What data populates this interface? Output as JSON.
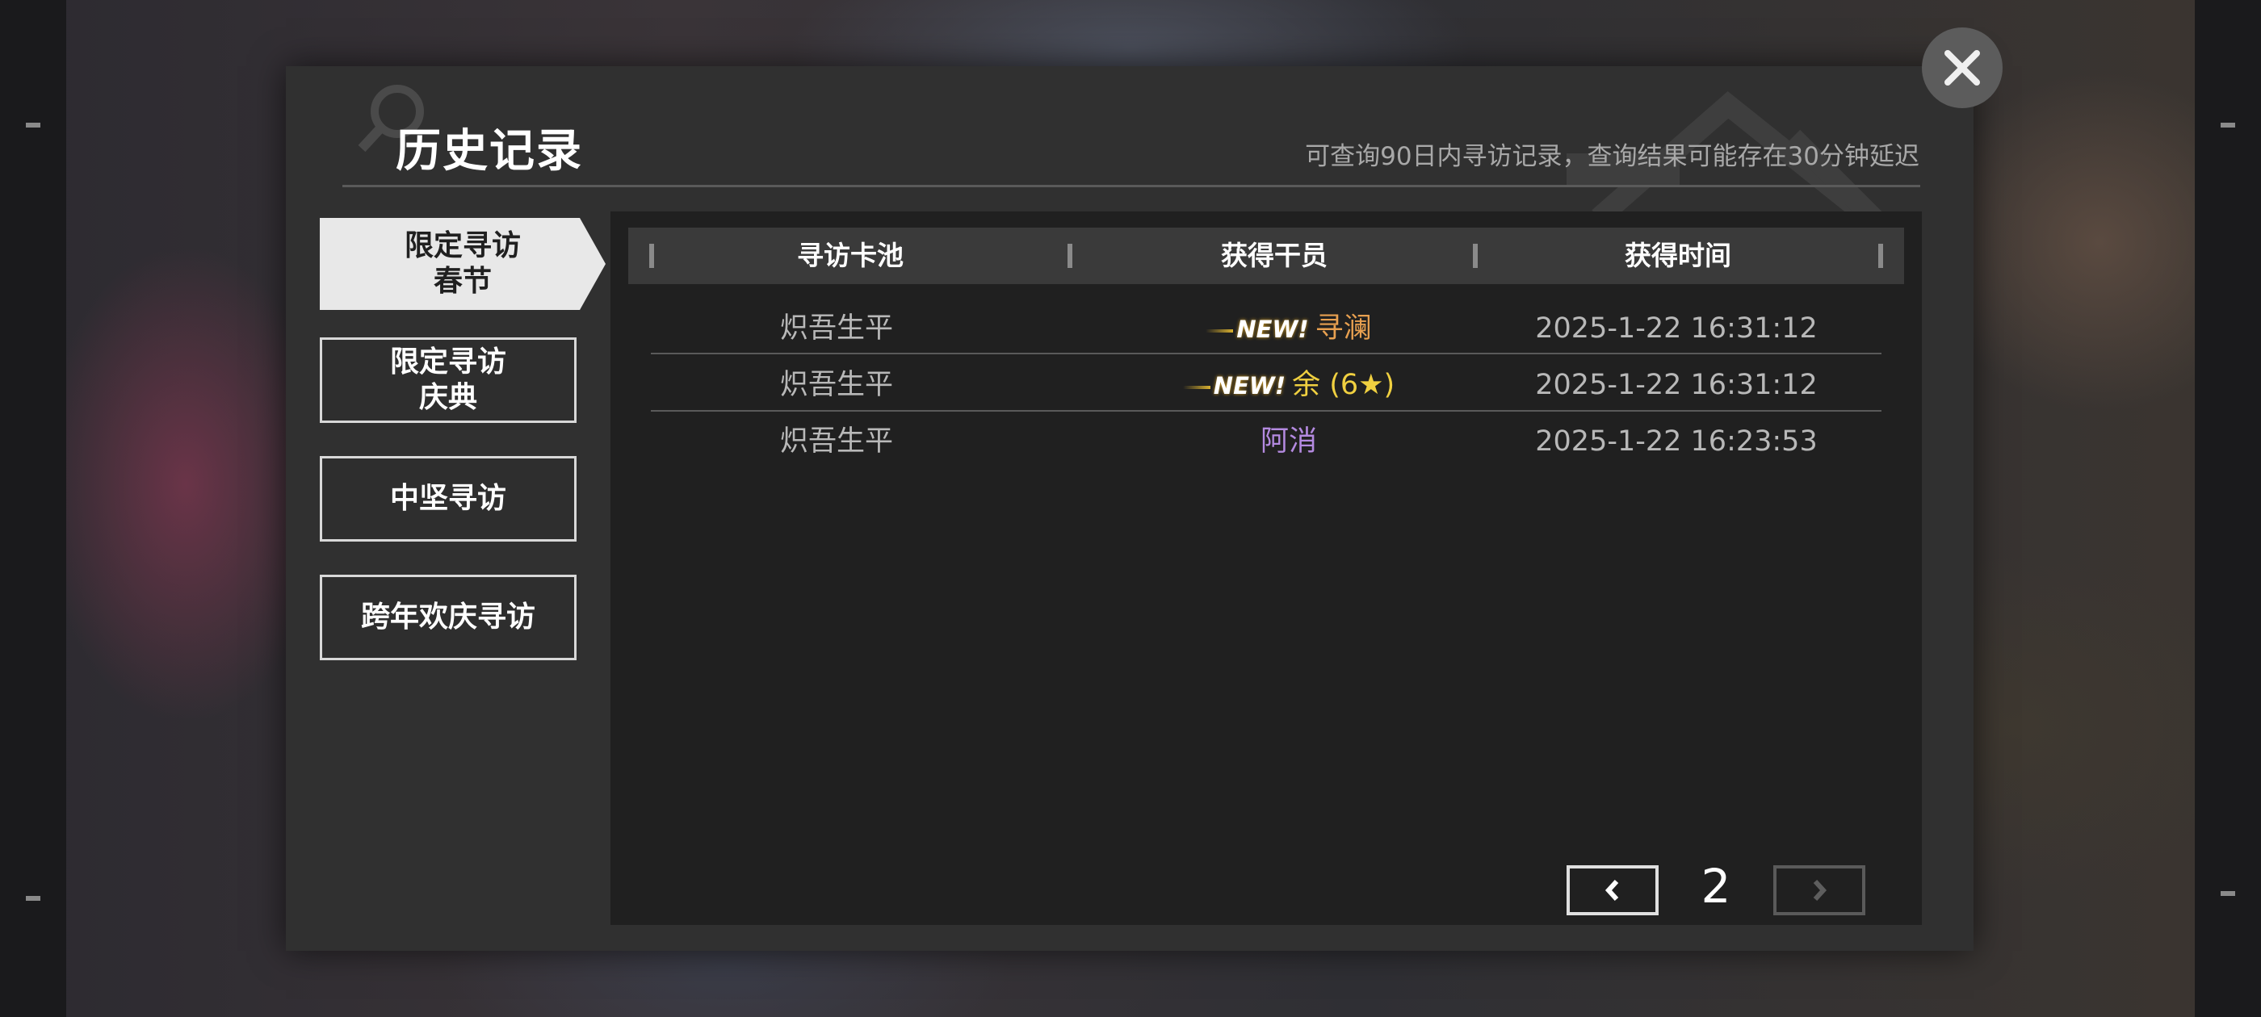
{
  "header": {
    "title": "历史记录",
    "subtitle": "可查询90日内寻访记录，查询结果可能存在30分钟延迟"
  },
  "close_icon": "close-icon",
  "sidebar": {
    "items": [
      {
        "line1": "限定寻访",
        "line2": "春节",
        "active": true
      },
      {
        "line1": "限定寻访",
        "line2": "庆典",
        "active": false
      },
      {
        "line1": "中坚寻访",
        "line2": "",
        "active": false
      },
      {
        "line1": "跨年欢庆寻访",
        "line2": "",
        "active": false
      }
    ]
  },
  "table": {
    "headers": [
      "寻访卡池",
      "获得干员",
      "获得时间"
    ],
    "rows": [
      {
        "pool": "炽吾生平",
        "badge": "NEW!",
        "operator": "寻澜",
        "operator_color": "#e8a050",
        "time": "2025-1-22 16:31:12"
      },
      {
        "pool": "炽吾生平",
        "badge": "NEW!",
        "operator": "余 (6★)",
        "operator_color": "#f0d040",
        "time": "2025-1-22 16:31:12"
      },
      {
        "pool": "炽吾生平",
        "badge": "",
        "operator": "阿消",
        "operator_color": "#b48ae0",
        "time": "2025-1-22 16:23:53"
      }
    ]
  },
  "pagination": {
    "page": "2",
    "prev_icon": "chevron-left-icon",
    "next_icon": "chevron-right-icon",
    "prev_enabled": true,
    "next_enabled": false
  }
}
